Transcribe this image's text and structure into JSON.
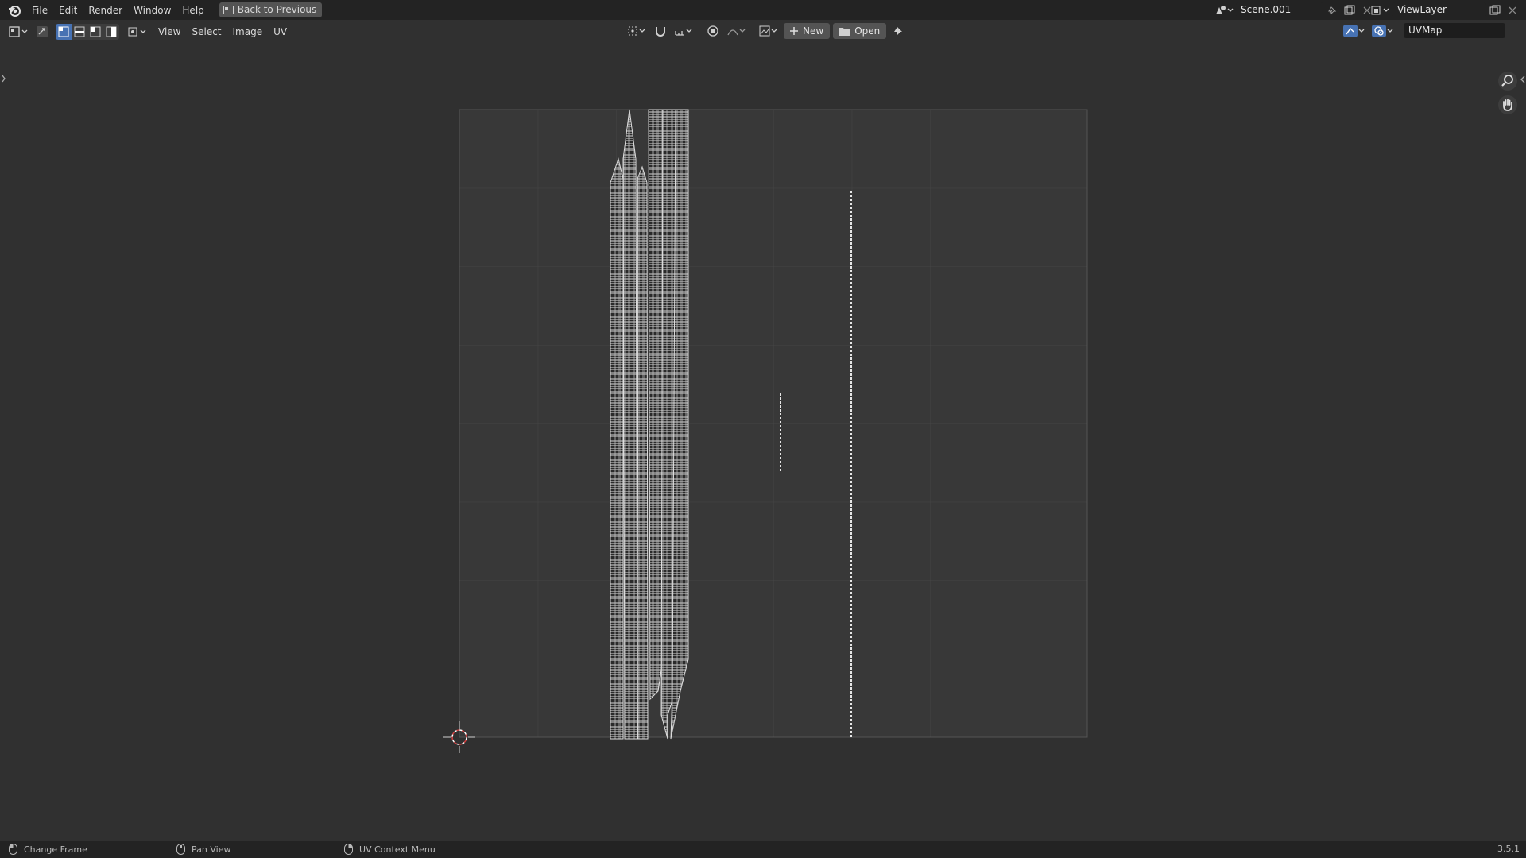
{
  "topbar": {
    "menus": [
      "File",
      "Edit",
      "Render",
      "Window",
      "Help"
    ],
    "back_label": "Back to Previous",
    "scene_name": "Scene.001",
    "view_layer": "ViewLayer"
  },
  "header": {
    "menus": [
      "View",
      "Select",
      "Image",
      "UV"
    ],
    "new_label": "New",
    "open_label": "Open",
    "uv_map": "UVMap"
  },
  "icons": {
    "logo": "blender-logo-icon",
    "editor": "uv-editor-type-icon",
    "zoom": "zoom-icon",
    "pan": "hand-pan-icon",
    "cursor": "2d-cursor-icon"
  },
  "status": {
    "left": "Change Frame",
    "middle": "Pan View",
    "right": "UV Context Menu",
    "version": "3.5.1"
  },
  "colors": {
    "background": "#303030",
    "topbar": "#232323",
    "accent": "#4772b3",
    "grid_bg": "#3a3a3a"
  }
}
